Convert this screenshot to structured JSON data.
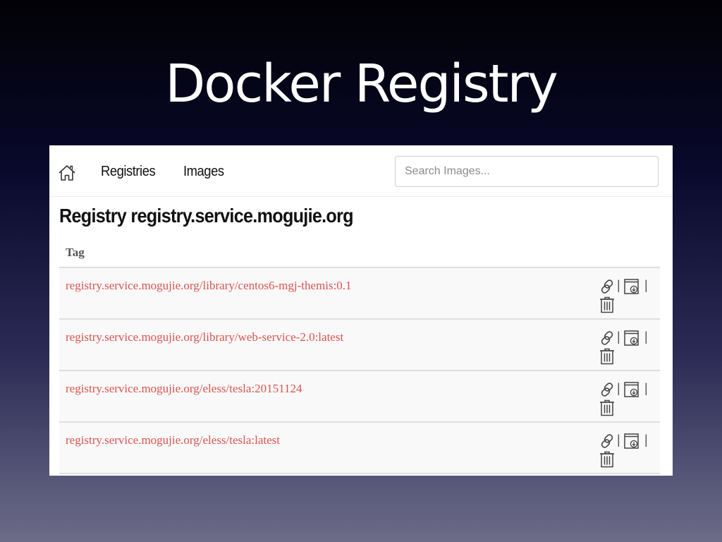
{
  "slide": {
    "title": "Docker Registry"
  },
  "navbar": {
    "home_icon": "home-icon",
    "links": [
      {
        "label": "Registries"
      },
      {
        "label": "Images"
      }
    ],
    "search": {
      "placeholder": "Search Images...",
      "value": ""
    }
  },
  "page": {
    "heading": "Registry registry.service.mogujie.org"
  },
  "table": {
    "header": "Tag",
    "rows": [
      {
        "tag": "registry.service.mogujie.org/library/centos6-mgj-themis:0.1"
      },
      {
        "tag": "registry.service.mogujie.org/library/web-service-2.0:latest"
      },
      {
        "tag": "registry.service.mogujie.org/eless/tesla:20151124"
      },
      {
        "tag": "registry.service.mogujie.org/eless/tesla:latest"
      }
    ],
    "action_separator": "|",
    "action_icons": [
      "link-icon",
      "pull-icon",
      "trash-icon"
    ]
  },
  "colors": {
    "tag_link": "#d9534f",
    "header_text": "#555555",
    "row_background": "#f9f9f9"
  }
}
